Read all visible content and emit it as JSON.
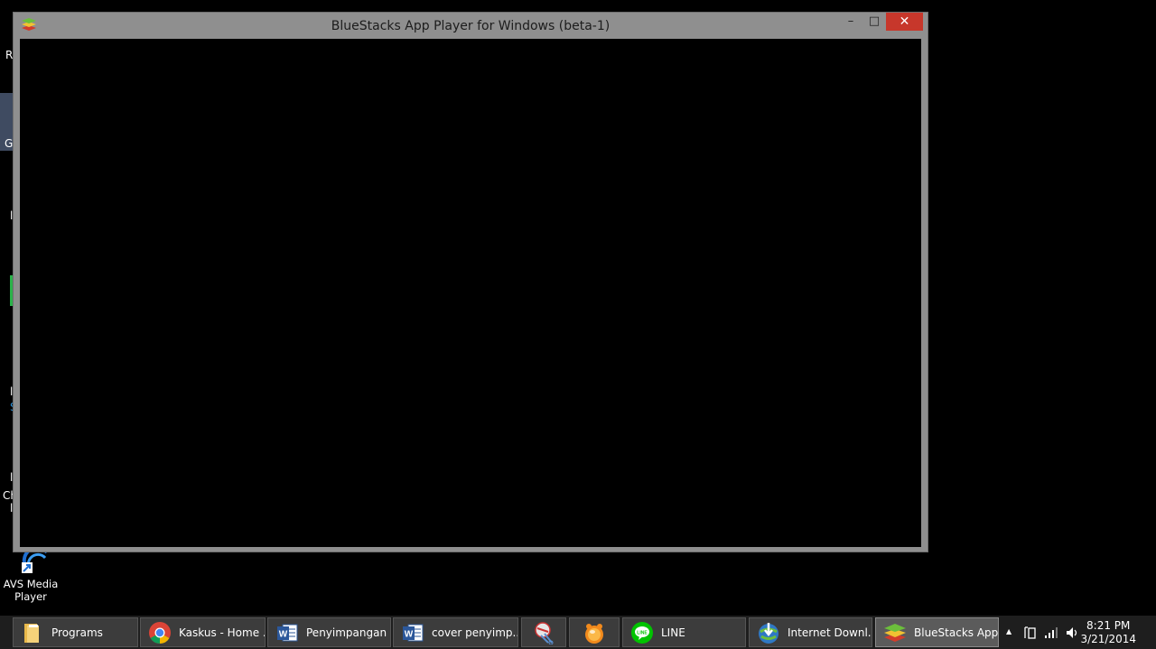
{
  "window": {
    "title": "BlueStacks App Player for Windows (beta-1)",
    "minimize_glyph": "–",
    "maximize_glyph": "□",
    "close_glyph": "✕"
  },
  "desktop": {
    "fragments": [
      "R",
      "G",
      "l",
      "l",
      "l",
      "S",
      "Ch",
      "l"
    ],
    "icon": {
      "label": "AVS Media Player"
    }
  },
  "taskbar": {
    "items": [
      {
        "label": "Programs",
        "icon": "folder-icon"
      },
      {
        "label": "Kaskus - Home ...",
        "icon": "chrome-icon"
      },
      {
        "label": "Penyimpangan ...",
        "icon": "word-icon"
      },
      {
        "label": "cover penyimp...",
        "icon": "word-icon"
      },
      {
        "label": "",
        "icon": "snipping-tool-icon"
      },
      {
        "label": "",
        "icon": "gom-player-icon"
      },
      {
        "label": "LINE",
        "icon": "line-icon"
      },
      {
        "label": "Internet Downl...",
        "icon": "internet-download-manager-icon"
      },
      {
        "label": "BlueStacks App...",
        "icon": "bluestacks-icon"
      }
    ],
    "tray": {
      "time": "8:21 PM",
      "date": "3/21/2014",
      "show_hidden": "▲"
    }
  },
  "colors": {
    "close_button": "#c7372b",
    "window_frame": "#8f8f8f",
    "taskbar": "#1e1e1e"
  }
}
